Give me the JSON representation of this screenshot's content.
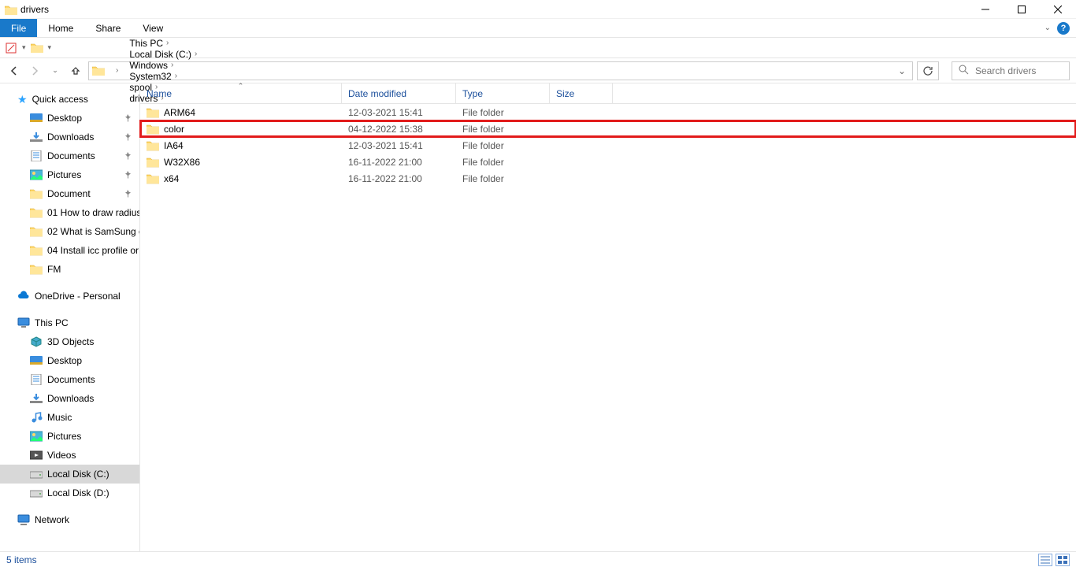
{
  "titlebar": {
    "title": "drivers"
  },
  "menu": {
    "file": "File",
    "home": "Home",
    "share": "Share",
    "view": "View"
  },
  "breadcrumbs": [
    "This PC",
    "Local Disk (C:)",
    "Windows",
    "System32",
    "spool",
    "drivers"
  ],
  "search": {
    "placeholder": "Search drivers"
  },
  "columns": {
    "name": "Name",
    "date": "Date modified",
    "type": "Type",
    "size": "Size"
  },
  "rows": [
    {
      "name": "ARM64",
      "date": "12-03-2021 15:41",
      "type": "File folder",
      "highlight": false
    },
    {
      "name": "color",
      "date": "04-12-2022 15:38",
      "type": "File folder",
      "highlight": true
    },
    {
      "name": "IA64",
      "date": "12-03-2021 15:41",
      "type": "File folder",
      "highlight": false
    },
    {
      "name": "W32X86",
      "date": "16-11-2022 21:00",
      "type": "File folder",
      "highlight": false
    },
    {
      "name": "x64",
      "date": "16-11-2022 21:00",
      "type": "File folder",
      "highlight": false
    }
  ],
  "sidebar": {
    "quickaccess": "Quick access",
    "pinned": [
      {
        "label": "Desktop",
        "icon": "desktop"
      },
      {
        "label": "Downloads",
        "icon": "downloads"
      },
      {
        "label": "Documents",
        "icon": "documents"
      },
      {
        "label": "Pictures",
        "icon": "pictures"
      },
      {
        "label": "Document",
        "icon": "folder"
      }
    ],
    "recent": [
      "01 How to draw radius",
      "02 What is SamSung c",
      "04 Install icc profile or",
      "FM"
    ],
    "onedrive": "OneDrive - Personal",
    "thispc": "This PC",
    "pcitems": [
      {
        "label": "3D Objects",
        "icon": "3d"
      },
      {
        "label": "Desktop",
        "icon": "desktop"
      },
      {
        "label": "Documents",
        "icon": "documents"
      },
      {
        "label": "Downloads",
        "icon": "downloads"
      },
      {
        "label": "Music",
        "icon": "music"
      },
      {
        "label": "Pictures",
        "icon": "pictures"
      },
      {
        "label": "Videos",
        "icon": "videos"
      },
      {
        "label": "Local Disk (C:)",
        "icon": "drive",
        "selected": true
      },
      {
        "label": "Local Disk (D:)",
        "icon": "drive"
      }
    ],
    "network": "Network"
  },
  "status": {
    "text": "5 items"
  }
}
